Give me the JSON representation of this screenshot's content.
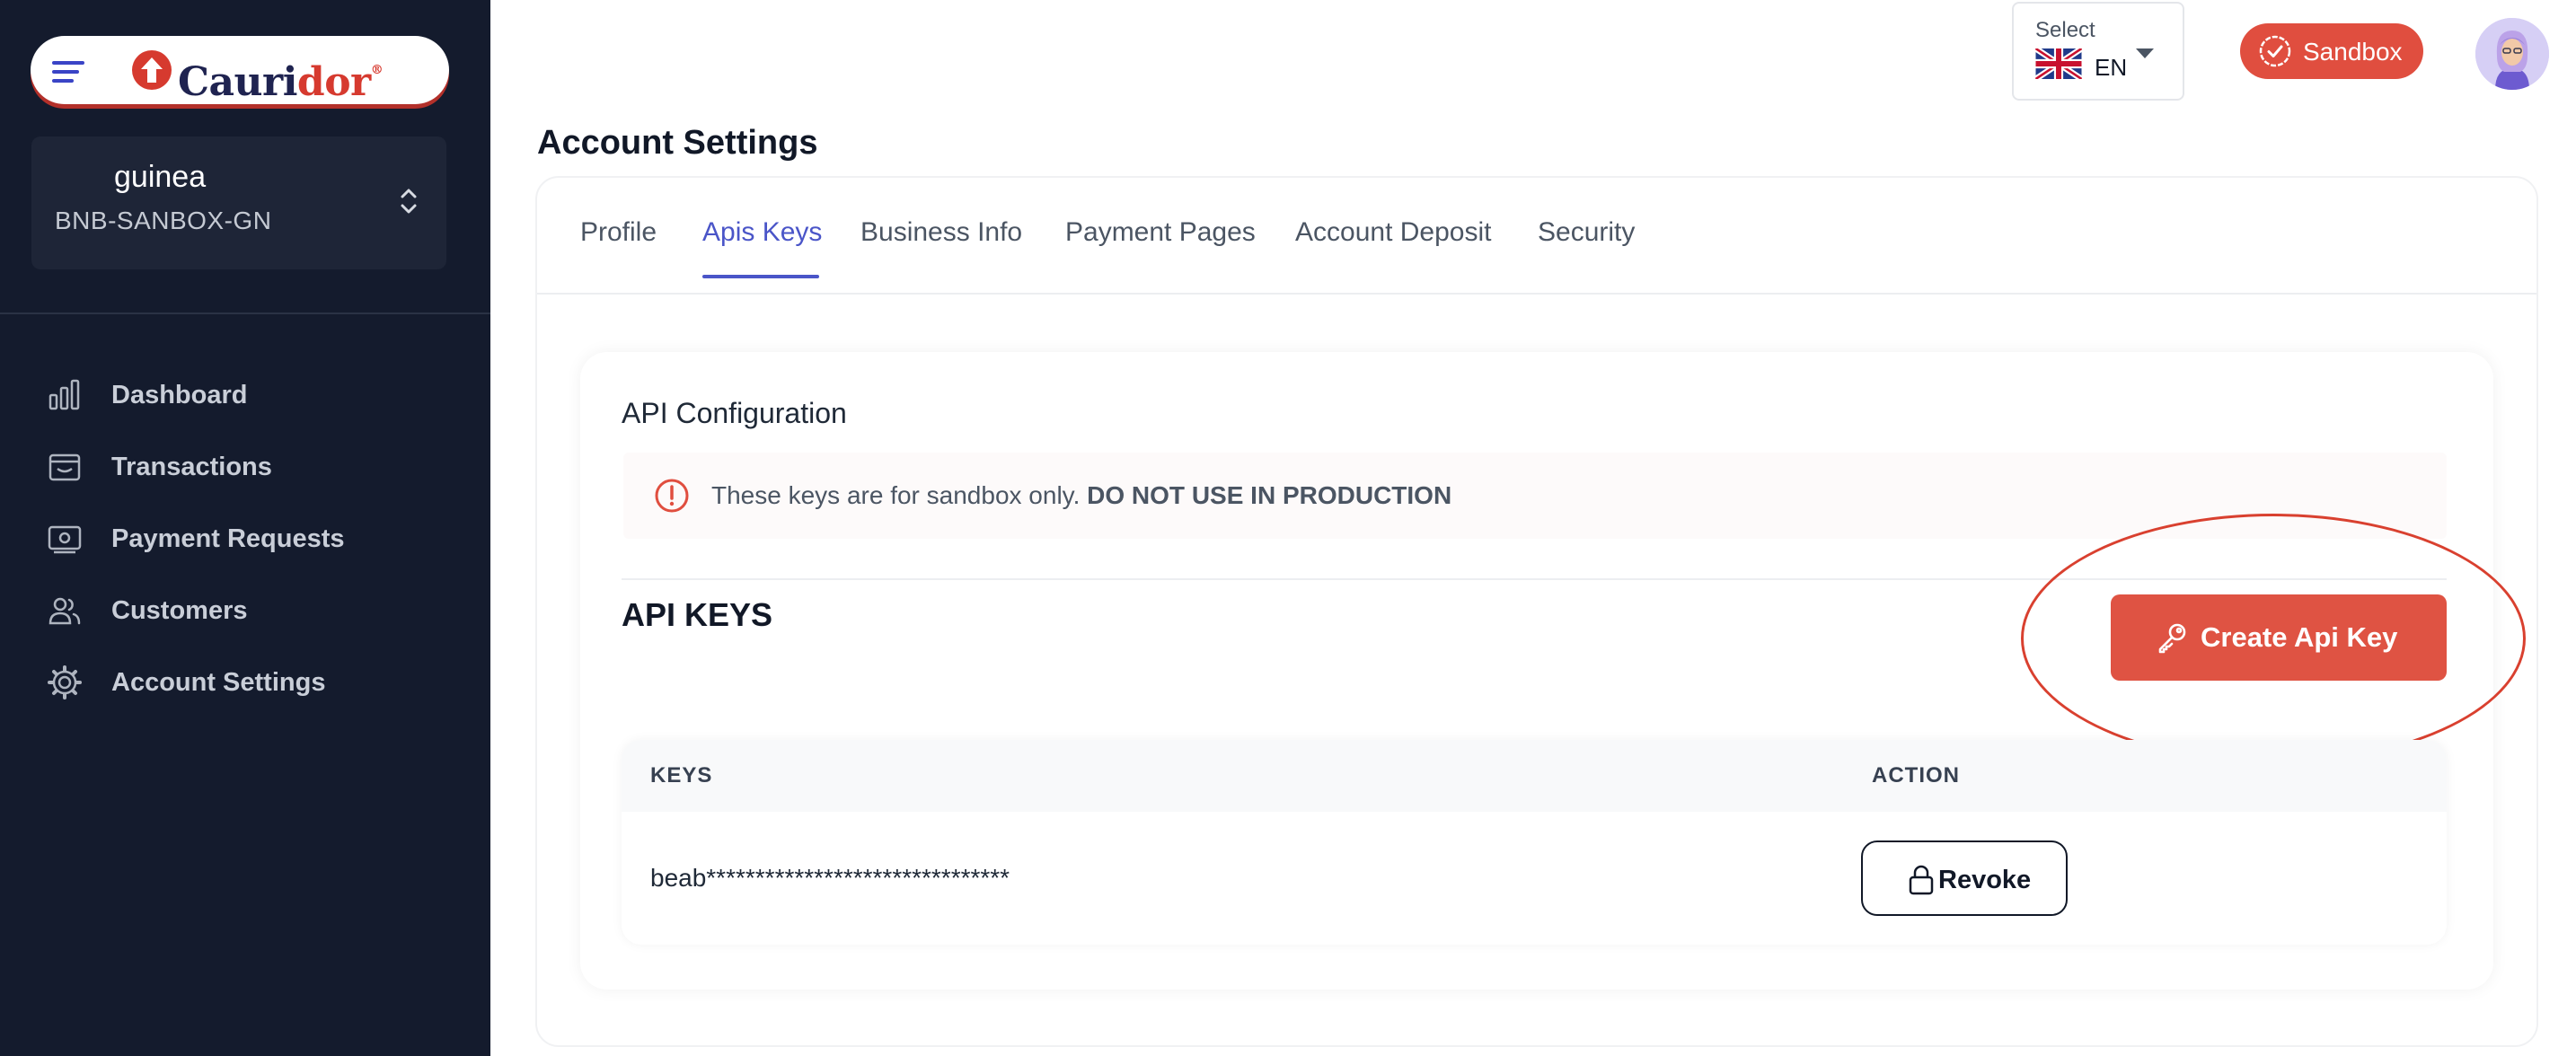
{
  "brand": {
    "logo_prefix": "Cauri",
    "logo_suffix": "dor",
    "logo_mark": "®",
    "accent_color": "#df5343",
    "sidebar_color": "#141b2d"
  },
  "account": {
    "name": "guinea",
    "code": "BNB-SANBOX-GN"
  },
  "sidebar": {
    "items": [
      {
        "label": "Dashboard",
        "icon": "bar-chart-icon"
      },
      {
        "label": "Transactions",
        "icon": "wallet-icon"
      },
      {
        "label": "Payment Requests",
        "icon": "money-request-icon"
      },
      {
        "label": "Customers",
        "icon": "users-icon"
      },
      {
        "label": "Account Settings",
        "icon": "gear-icon"
      }
    ]
  },
  "header": {
    "language": {
      "caption": "Select",
      "value": "EN",
      "flag": "uk-flag-icon"
    },
    "environment_badge": "Sandbox"
  },
  "page": {
    "title": "Account Settings",
    "tabs": [
      {
        "label": "Profile"
      },
      {
        "label": "Apis Keys",
        "active": true
      },
      {
        "label": "Business Info"
      },
      {
        "label": "Payment Pages"
      },
      {
        "label": "Account Deposit"
      },
      {
        "label": "Security"
      }
    ]
  },
  "api": {
    "config_title": "API Configuration",
    "warning_text": "These keys are for sandbox only.",
    "warning_emphasis": "DO NOT USE IN PRODUCTION",
    "section_title": "API KEYS",
    "create_button": "Create Api Key",
    "table": {
      "columns": [
        "KEYS",
        "ACTION"
      ],
      "rows": [
        {
          "key": "beab*******************************",
          "action": "Revoke"
        }
      ]
    }
  }
}
